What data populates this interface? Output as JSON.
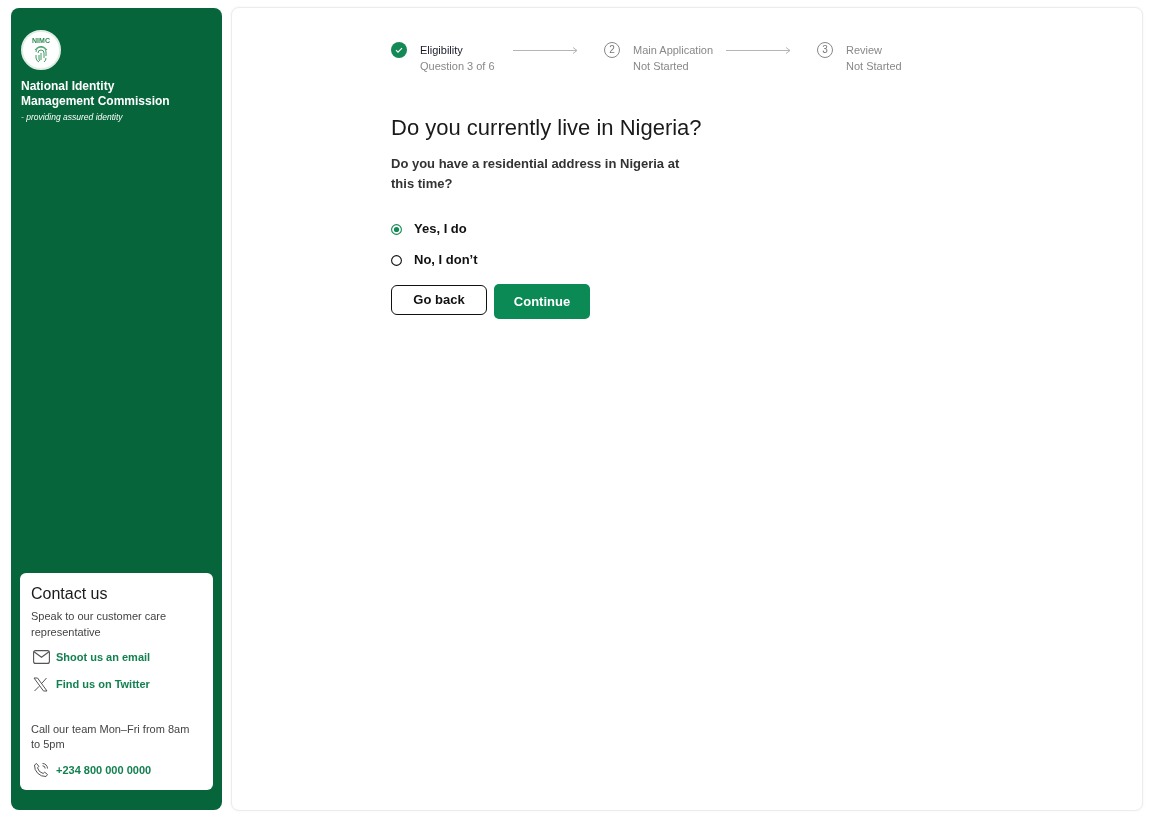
{
  "sidebar": {
    "logo": {
      "text": "NIMC"
    },
    "org_name": "National Identity Management Commission",
    "tagline": "- providing assured identity",
    "contact": {
      "title": "Contact us",
      "description": "Speak to our customer care representative",
      "links": [
        {
          "kind": "email",
          "label": "Shoot us an email"
        },
        {
          "kind": "twitter",
          "label": "Find us on Twitter"
        }
      ],
      "hours": "Call our team Mon–Fri from 8am to 5pm",
      "phone": "+234 800 000 0000"
    }
  },
  "steps": [
    {
      "label": "Eligibility",
      "status": "Question 3 of 6",
      "completed": true
    },
    {
      "number": "2",
      "label": "Main Application",
      "status": "Not Started",
      "completed": false
    },
    {
      "number": "3",
      "label": "Review",
      "status": "Not Started",
      "completed": false
    }
  ],
  "question": {
    "title": "Do you currently live in Nigeria?",
    "description": "Do you have a residential address in Nigeria at this time?",
    "options": [
      {
        "label": "Yes, I do",
        "selected": true
      },
      {
        "label": "No, I don’t",
        "selected": false
      }
    ]
  },
  "buttons": [
    {
      "kind": "secondary",
      "label": "Go back"
    },
    {
      "kind": "primary",
      "label": "Continue"
    }
  ]
}
